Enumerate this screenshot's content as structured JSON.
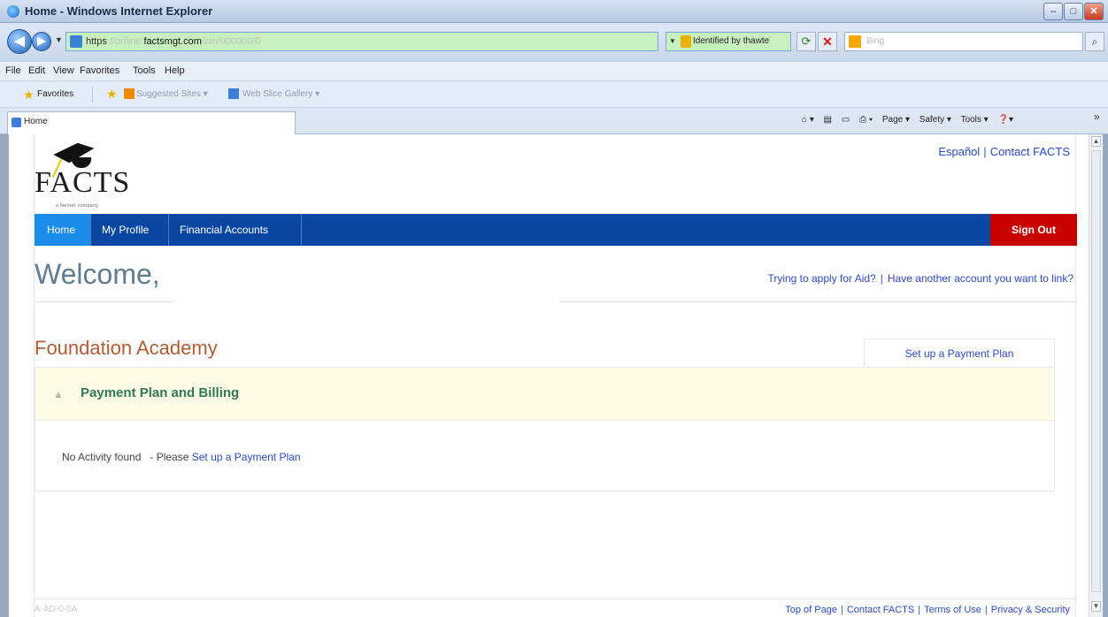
{
  "window": {
    "title": "Home - Windows Internet Explorer",
    "controls": {
      "minimize": "–",
      "maximize": "□",
      "close": "✕"
    }
  },
  "address_bar": {
    "url_protocol": "https",
    "url_blurred_prefix": "://online.",
    "url_domain": "factsmgt.com",
    "url_blurred_suffix": "/cm/000000/0",
    "identity": "Identified by thawte",
    "search_placeholder": "Bing"
  },
  "menu": [
    "File",
    "Edit",
    "View",
    "Favorites",
    "Tools",
    "Help"
  ],
  "favorites_bar": {
    "favorites_label": "Favorites",
    "suggested_sites": "Suggested Sites ▾",
    "web_slice_gallery": "Web Slice Gallery ▾"
  },
  "tab": {
    "label": "Home"
  },
  "command_bar": [
    "Page ▾",
    "Safety ▾",
    "Tools ▾"
  ],
  "page": {
    "logo_text": "FACTS",
    "logo_sub": "a Nelnet company",
    "top_links": {
      "espanol": "Español",
      "contact": "Contact FACTS"
    },
    "nav": {
      "home": "Home",
      "profile": "My Profile",
      "financial": "Financial Accounts",
      "sign_out": "Sign Out"
    },
    "welcome": "Welcome,",
    "aid_links": {
      "apply": "Trying to apply for Aid?",
      "link_account": "Have another account you want to link?"
    },
    "school_name": "Foundation Academy",
    "setup_tab": "Set up a Payment Plan",
    "panel_title": "Payment Plan and Billing",
    "no_activity_text": "No Activity found   - Please ",
    "no_activity_link": "Set up a Payment Plan",
    "footer_code": "A-AD-0-0A",
    "footer_links": {
      "top": "Top of Page",
      "contact": "Contact FACTS",
      "terms": "Terms of Use",
      "privacy": "Privacy & Security"
    }
  }
}
